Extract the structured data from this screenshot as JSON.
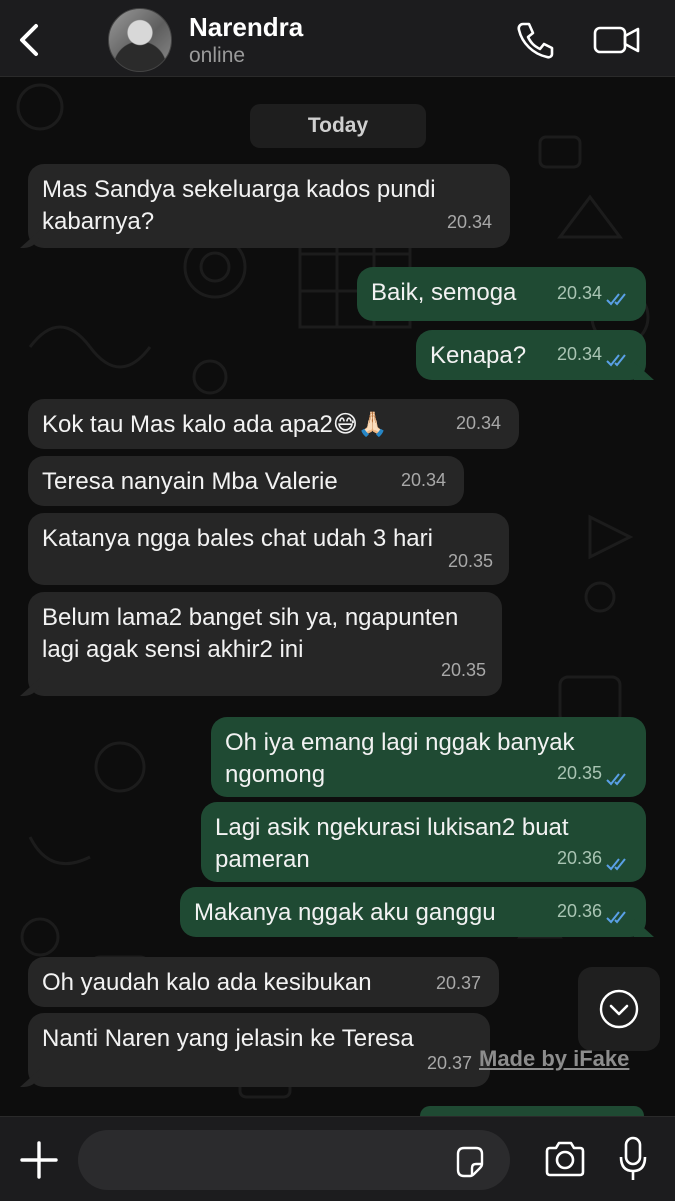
{
  "header": {
    "name": "Narendra",
    "status": "online"
  },
  "chat": {
    "date_label": "Today",
    "messages": [
      {
        "dir": "in",
        "text": "Mas Sandya sekeluarga kados pundi kabarnya?",
        "time": "20.34"
      },
      {
        "dir": "out",
        "text": "Baik, semoga",
        "time": "20.34",
        "read": true
      },
      {
        "dir": "out",
        "text": "Kenapa?",
        "time": "20.34",
        "read": true
      },
      {
        "dir": "in",
        "text": "Kok tau Mas kalo ada apa2😅🙏🏻",
        "time": "20.34"
      },
      {
        "dir": "in",
        "text": "Teresa nanyain Mba Valerie",
        "time": "20.34"
      },
      {
        "dir": "in",
        "text": "Katanya ngga bales chat udah 3 hari",
        "time": "20.35"
      },
      {
        "dir": "in",
        "text": "Belum lama2 banget sih ya, ngapunten lagi agak sensi akhir2 ini",
        "time": "20.35"
      },
      {
        "dir": "out",
        "text": "Oh iya emang lagi nggak banyak ngomong",
        "time": "20.35",
        "read": true
      },
      {
        "dir": "out",
        "text": "Lagi asik ngekurasi lukisan2 buat pameran",
        "time": "20.36",
        "read": true
      },
      {
        "dir": "out",
        "text": "Makanya nggak aku ganggu",
        "time": "20.36",
        "read": true
      },
      {
        "dir": "in",
        "text": "Oh yaudah kalo ada kesibukan",
        "time": "20.37"
      },
      {
        "dir": "in",
        "text": "Nanti Naren yang jelasin ke Teresa",
        "time": "20.37"
      }
    ],
    "watermark": "Made by iFake"
  },
  "colors": {
    "incoming_bubble": "#262626",
    "outgoing_bubble": "#1f4a33",
    "read_ticks": "#5aa0e6",
    "header_bg": "#1c1c1e"
  },
  "icons": {
    "back": "chevron-left-icon",
    "call": "phone-icon",
    "video": "video-camera-icon",
    "scroll": "chevron-down-circle-icon",
    "attach": "plus-icon",
    "sticker": "sticker-icon",
    "camera": "camera-icon",
    "mic": "microphone-icon"
  }
}
